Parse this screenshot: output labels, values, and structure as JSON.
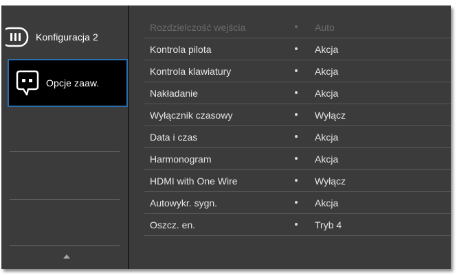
{
  "sidebar": {
    "items": [
      {
        "label": "Konfiguracja 2",
        "icon": "config-icon"
      },
      {
        "label": "Opcje zaaw.",
        "icon": "chat-icon",
        "selected": true
      }
    ],
    "scroll_up_icon": "up-arrow-icon"
  },
  "settings": {
    "bullet": "•",
    "rows": [
      {
        "label": "Rozdzielczość wejścia",
        "value": "Auto",
        "enabled": false
      },
      {
        "label": "Kontrola pilota",
        "value": "Akcja"
      },
      {
        "label": "Kontrola klawiatury",
        "value": "Akcja"
      },
      {
        "label": "Nakładanie",
        "value": "Akcja"
      },
      {
        "label": "Wyłącznik czasowy",
        "value": "Wyłącz"
      },
      {
        "label": "Data i czas",
        "value": "Akcja"
      },
      {
        "label": "Harmonogram",
        "value": "Akcja"
      },
      {
        "label": "HDMI with One Wire",
        "value": "Wyłącz"
      },
      {
        "label": "Autowykr. sygn.",
        "value": "Akcja"
      },
      {
        "label": "Oszcz. en.",
        "value": "Tryb 4"
      }
    ]
  },
  "colors": {
    "panel": "#3b3b3b",
    "selected_bg": "#000000",
    "selected_border": "#2b6fae",
    "text": "#e6e6e6",
    "disabled_text": "#6a6a6a"
  }
}
